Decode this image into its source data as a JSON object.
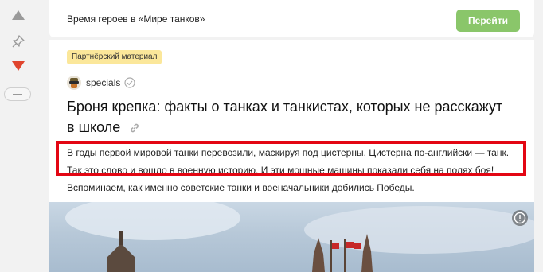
{
  "promo": {
    "text": "Время героев в «Мире танков»",
    "button_label": "Перейти"
  },
  "article": {
    "badge": "Партнёрский материал",
    "author": "specials",
    "title": "Броня крепка: факты о танках и танкистах, которых не расскажут в школе",
    "lead": "В годы первой мировой танки перевозили, маскируя под цистерны. Цистерна по-английски — танк. Так это слово и вошло в военную историю. И эти мощные машины показали себя на полях боя! Вспоминаем, как именно советские танки и военачальники добились Победы."
  },
  "colors": {
    "accent_button": "#8ac66a",
    "badge": "#fbe79a",
    "highlight": "#e30613",
    "downvote": "#e0452e"
  },
  "icons": [
    "upvote-arrow-icon",
    "pin-icon",
    "downvote-arrow-icon",
    "verified-check-icon",
    "link-icon",
    "info-icon"
  ]
}
